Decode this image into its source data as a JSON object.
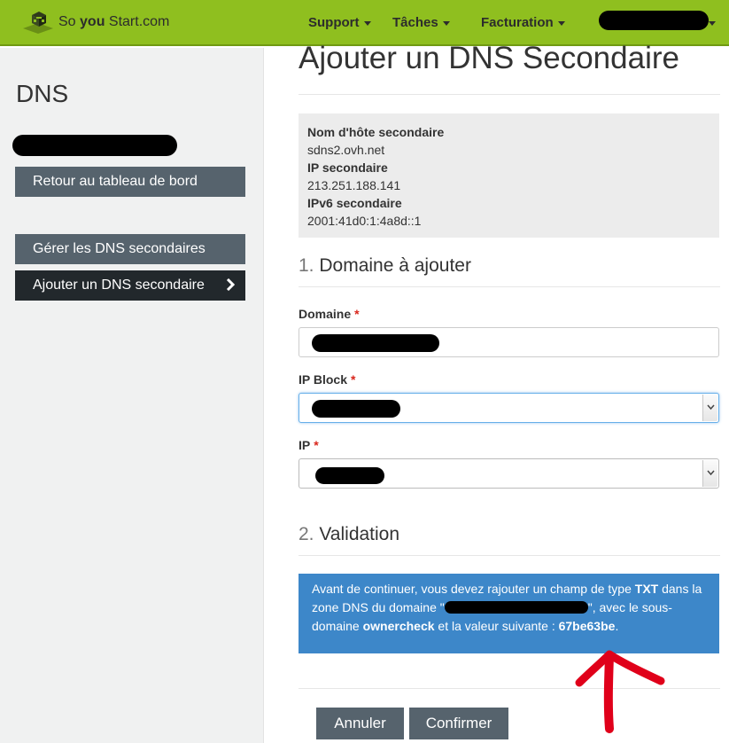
{
  "header": {
    "logo": {
      "prefix": "So ",
      "brand": "you",
      "suffix": " Start.com"
    },
    "nav": [
      {
        "label": "Support"
      },
      {
        "label": "Tâches"
      },
      {
        "label": "Facturation"
      }
    ],
    "account_label_redacted": true
  },
  "sidebar": {
    "title": "DNS",
    "back_button": "Retour au tableau de bord",
    "items": [
      {
        "label": "Gérer les DNS secondaires",
        "active": false
      },
      {
        "label": "Ajouter un DNS secondaire",
        "active": true
      }
    ]
  },
  "main": {
    "title": "Ajouter un DNS Secondaire",
    "info": {
      "hostname_label": "Nom d'hôte secondaire",
      "hostname_value": "sdns2.ovh.net",
      "ip_label": "IP secondaire",
      "ip_value": "213.251.188.141",
      "ipv6_label": "IPv6 secondaire",
      "ipv6_value": "2001:41d0:1:4a8d::1"
    },
    "section1": {
      "number": "1.",
      "title": "Domaine à ajouter"
    },
    "fields": {
      "domain_label": "Domaine",
      "ipblock_label": "IP Block",
      "ip_label": "IP",
      "required_mark": "*"
    },
    "section2": {
      "number": "2.",
      "title": "Validation"
    },
    "alert": {
      "text_1": "Avant de continuer, vous devez rajouter un champ de type ",
      "type": "TXT",
      "text_2": " dans la zone DNS du domaine \"",
      "text_3": "\", avec le sous-domaine ",
      "subdomain": "ownercheck",
      "text_4": " et la valeur suivante : ",
      "value": "67be63be",
      "text_5": "."
    },
    "buttons": {
      "cancel": "Annuler",
      "confirm": "Confirmer"
    }
  },
  "colors": {
    "header_bg": "#8fbf1f",
    "sidebar_button": "#56636d",
    "sidebar_button_active": "#22282c",
    "alert_bg": "#3d87c9",
    "required": "#d9261c",
    "annotation_arrow": "#e0001a"
  },
  "icons": {
    "logo": "cube-logo-icon",
    "active_item": "chevron-right-icon",
    "select": "chevron-down-icon",
    "annotation": "hand-drawn-arrow-icon"
  }
}
